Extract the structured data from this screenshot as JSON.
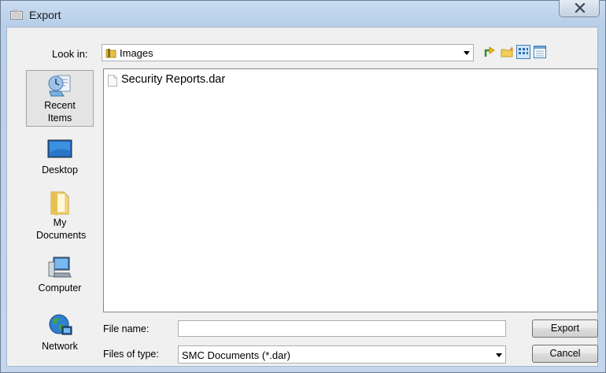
{
  "window": {
    "title": "Export"
  },
  "lookin": {
    "label": "Look in:",
    "value": "Images"
  },
  "places": [
    {
      "label": "Recent Items",
      "icon": "recent-items-icon"
    },
    {
      "label": "Desktop",
      "icon": "desktop-icon"
    },
    {
      "label": "My Documents",
      "icon": "my-documents-icon"
    },
    {
      "label": "Computer",
      "icon": "computer-icon"
    },
    {
      "label": "Network",
      "icon": "network-icon"
    }
  ],
  "files": [
    {
      "name": "Security Reports.dar"
    }
  ],
  "form": {
    "file_name_label": "File name:",
    "file_name_value": "",
    "file_type_label": "Files of type:",
    "file_type_value": "SMC Documents (*.dar)"
  },
  "buttons": {
    "primary": "Export",
    "cancel": "Cancel"
  },
  "colors": {
    "title_bar": "#c9dcf2",
    "client": "#f0f0f0",
    "folder": "#e8c04a"
  }
}
